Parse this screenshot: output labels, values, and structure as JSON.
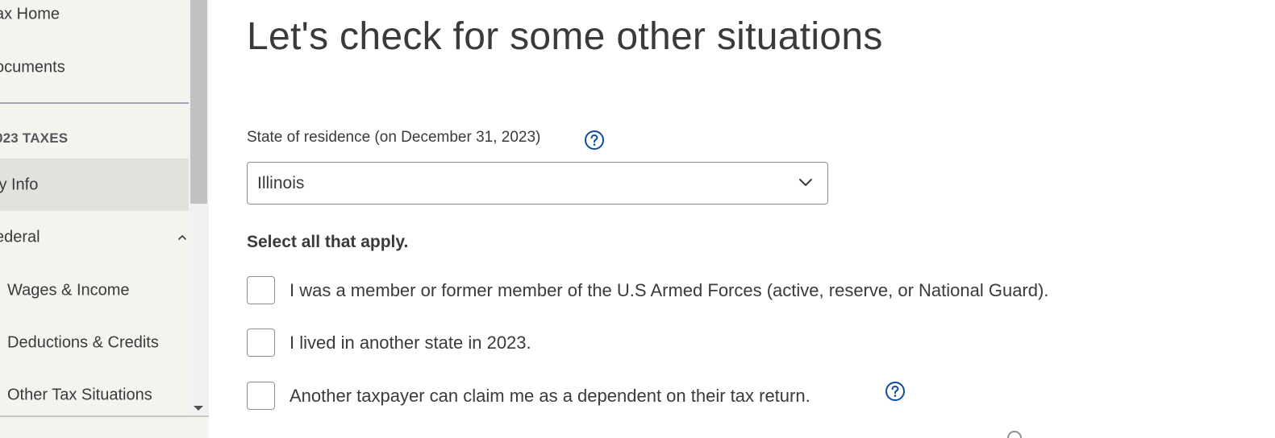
{
  "sidebar": {
    "items": [
      {
        "label": "ax Home"
      },
      {
        "label": "ocuments"
      }
    ],
    "section_header": "023 TAXES",
    "tax_items": [
      {
        "label": "ly Info"
      },
      {
        "label": "ederal"
      },
      {
        "label": "Wages & Income"
      },
      {
        "label": "Deductions & Credits"
      },
      {
        "label": "Other Tax Situations"
      }
    ]
  },
  "main": {
    "title": "Let's check for some other situations",
    "state_field": {
      "label": "State of residence (on December 31, 2023)",
      "value": "Illinois"
    },
    "instruction": "Select all that apply.",
    "options": [
      {
        "label": "I was a member or former member of the U.S Armed Forces (active, reserve, or National Guard).",
        "checked": false
      },
      {
        "label": "I lived in another state in 2023.",
        "checked": false
      },
      {
        "label": "Another taxpayer can claim me as a dependent on their tax return.",
        "checked": false
      }
    ]
  },
  "colors": {
    "sidebar_bg": "#f4f4ef",
    "active_item_bg": "#e2e2dd",
    "help_icon": "#0d4a9e",
    "text": "#393a3d"
  },
  "icons": {
    "help": "question-circle-icon",
    "select_chevron": "chevron-down-icon",
    "federal_expand": "chevron-up-icon"
  }
}
